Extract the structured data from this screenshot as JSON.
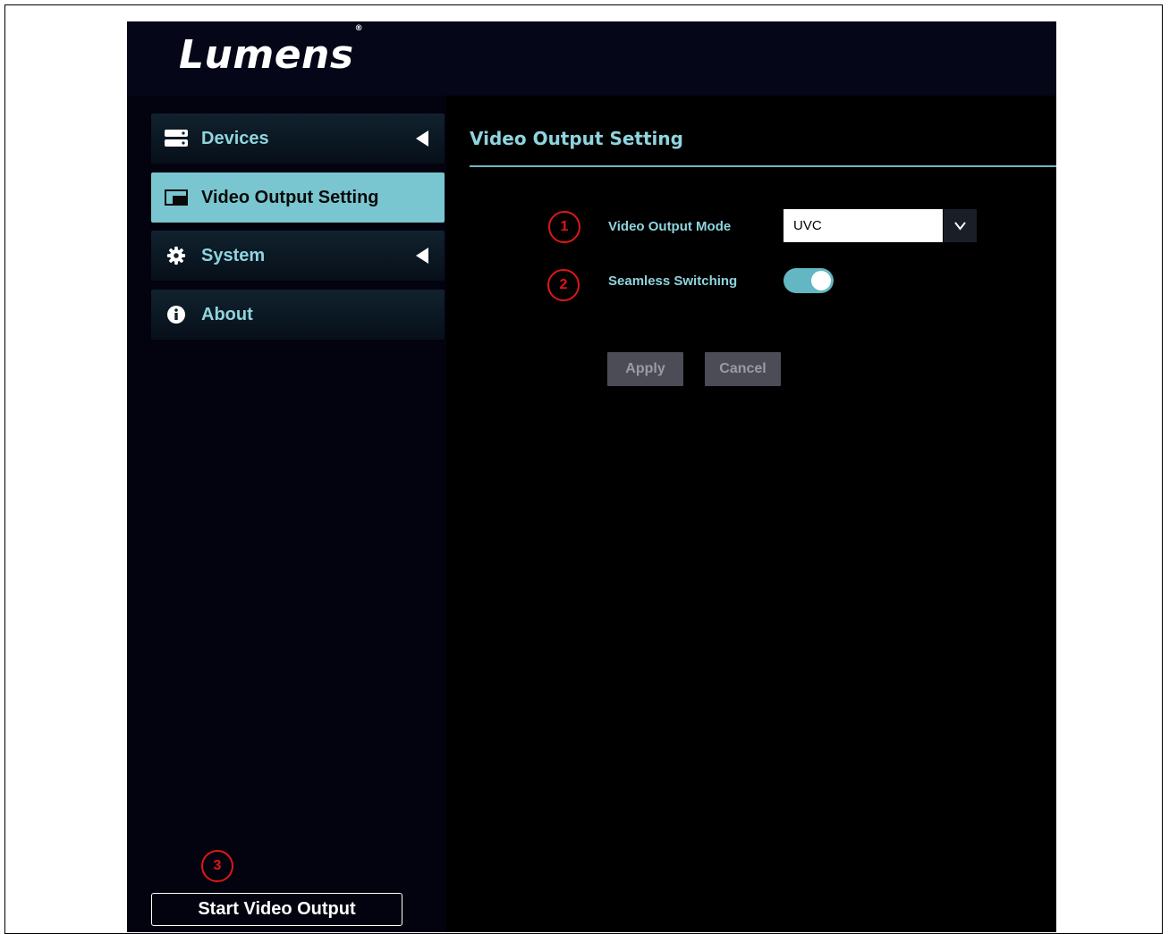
{
  "brand": {
    "logo_text": "Lumens",
    "registered_mark": "®"
  },
  "sidebar": {
    "items": [
      {
        "label": "Devices",
        "icon": "server-icon",
        "has_caret": true,
        "active": false
      },
      {
        "label": "Video Output Setting",
        "icon": "window-icon",
        "has_caret": false,
        "active": true
      },
      {
        "label": "System",
        "icon": "gear-icon",
        "has_caret": true,
        "active": false
      },
      {
        "label": "About",
        "icon": "info-icon",
        "has_caret": false,
        "active": false
      }
    ],
    "start_button": "Start Video Output"
  },
  "main": {
    "title": "Video Output Setting",
    "fields": {
      "output_mode": {
        "label": "Video Output Mode",
        "value": "UVC"
      },
      "seamless": {
        "label": "Seamless Switching",
        "enabled": true
      }
    },
    "buttons": {
      "apply": "Apply",
      "cancel": "Cancel"
    }
  },
  "callouts": [
    "1",
    "2",
    "3"
  ],
  "colors": {
    "accent": "#79c6d1",
    "label_text": "#8fd4de",
    "background": "#03020f",
    "callout": "#e01616",
    "disabled_button": "#4b4c55"
  }
}
